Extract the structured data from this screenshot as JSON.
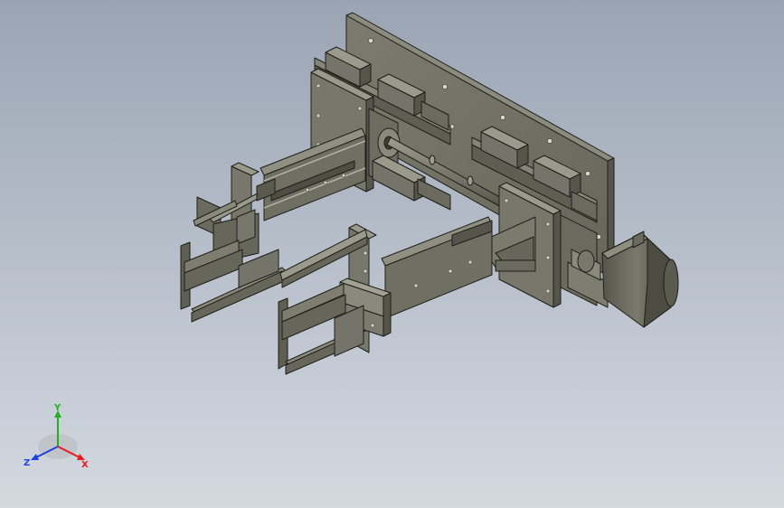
{
  "viewport": {
    "background_top": "#9aa4b3",
    "background_bottom": "#d4d9e0",
    "part_color": "#6f6f62",
    "part_highlight": "#8a8a7c",
    "edge_color": "#1f1f1a"
  },
  "triad": {
    "x_label": "X",
    "y_label": "Y",
    "z_label": "Z",
    "x_color": "#e02020",
    "y_color": "#20b020",
    "z_color": "#2040e0"
  }
}
